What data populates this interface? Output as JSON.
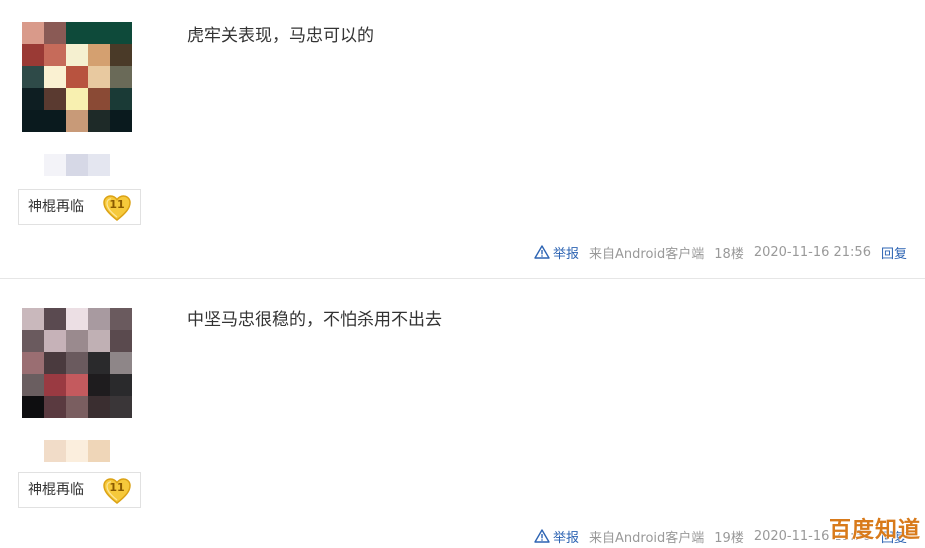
{
  "posts": [
    {
      "content": "虎牢关表现，马忠可以的",
      "tag_name": "神棍再临",
      "tag_level": "11",
      "report": "举报",
      "source": "来自Android客户端",
      "floor": "18楼",
      "time": "2020-11-16 21:56",
      "reply": "回复",
      "avatar_colors": [
        "#d99a8a",
        "#8a5a55",
        "#0e4a3a",
        "#0e4a3a",
        "#0e4a3a",
        "#9a3a35",
        "#c66b5a",
        "#f5f0d0",
        "#d4a070",
        "#4a3a28",
        "#2e4a48",
        "#faf1d2",
        "#b8533f",
        "#e8c9a0",
        "#6a6a58",
        "#0e1e22",
        "#5a3a30",
        "#f8f0b0",
        "#8a4a35",
        "#1a3a36",
        "#0a1a1e",
        "#0a1a1e",
        "#c89a78",
        "#1e2a28",
        "#0a1a1e"
      ],
      "name_blur_colors": [
        "#f3f3f8",
        "#d6d8e6",
        "#e4e6f0"
      ]
    },
    {
      "content": "中坚马忠很稳的，不怕杀用不出去",
      "tag_name": "神棍再临",
      "tag_level": "11",
      "report": "举报",
      "source": "来自Android客户端",
      "floor": "19楼",
      "time": "2020-11-16 21:58",
      "reply": "回复",
      "avatar_colors": [
        "#c9b8bc",
        "#5a4a50",
        "#ecdfe4",
        "#a89aa0",
        "#6a5a5e",
        "#6a5a5e",
        "#c6b2b8",
        "#9a8a8e",
        "#c0b0b4",
        "#5a4a4e",
        "#9a6e72",
        "#4a3a3e",
        "#6a5a5e",
        "#2a2a2c",
        "#8e8688",
        "#6a5e60",
        "#9a3a42",
        "#c45a5e",
        "#1e1c1e",
        "#2a2a2c",
        "#0e0e10",
        "#5a3a40",
        "#7a5e60",
        "#3a2e30",
        "#3a3638"
      ],
      "name_blur_colors": [
        "#f1dcc8",
        "#fbeedd",
        "#efd6b8"
      ]
    }
  ],
  "watermark": "百度知道"
}
